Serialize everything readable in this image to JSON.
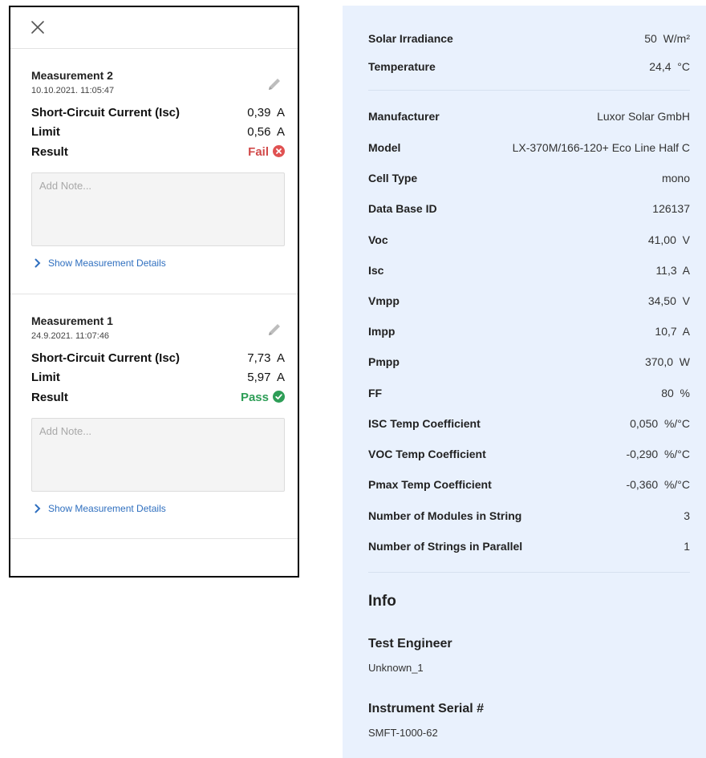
{
  "measurements": [
    {
      "title": "Measurement 2",
      "date": "10.10.2021. 11:05:47",
      "isc_label": "Short-Circuit Current (Isc)",
      "isc_value": "0,39  A",
      "limit_label": "Limit",
      "limit_value": "0,56  A",
      "result_label": "Result",
      "result_value": "Fail",
      "result_status": "fail",
      "note_placeholder": "Add Note...",
      "details_link": "Show Measurement Details"
    },
    {
      "title": "Measurement 1",
      "date": "24.9.2021. 11:07:46",
      "isc_label": "Short-Circuit Current (Isc)",
      "isc_value": "7,73  A",
      "limit_label": "Limit",
      "limit_value": "5,97  A",
      "result_label": "Result",
      "result_value": "Pass",
      "result_status": "pass",
      "note_placeholder": "Add Note...",
      "details_link": "Show Measurement Details"
    }
  ],
  "conditions": [
    {
      "label": "Solar Irradiance",
      "value": "50  W/m²"
    },
    {
      "label": "Temperature",
      "value": "24,4  °C"
    }
  ],
  "module": [
    {
      "label": "Manufacturer",
      "value": "Luxor Solar GmbH"
    },
    {
      "label": "Model",
      "value": "LX-370M/166-120+ Eco Line Half C"
    },
    {
      "label": "Cell Type",
      "value": "mono"
    },
    {
      "label": "Data Base ID",
      "value": "126137"
    },
    {
      "label": "Voc",
      "value": "41,00  V"
    },
    {
      "label": "Isc",
      "value": "11,3  A"
    },
    {
      "label": "Vmpp",
      "value": "34,50  V"
    },
    {
      "label": "Impp",
      "value": "10,7  A"
    },
    {
      "label": "Pmpp",
      "value": "370,0  W"
    },
    {
      "label": "FF",
      "value": "80  %"
    },
    {
      "label": "ISC Temp Coefficient",
      "value": "0,050  %/°C"
    },
    {
      "label": "VOC Temp Coefficient",
      "value": "-0,290  %/°C"
    },
    {
      "label": "Pmax Temp Coefficient",
      "value": "-0,360  %/°C"
    },
    {
      "label": "Number of Modules in String",
      "value": "3"
    },
    {
      "label": "Number of Strings in Parallel",
      "value": "1"
    }
  ],
  "info": {
    "heading": "Info",
    "test_engineer_label": "Test Engineer",
    "test_engineer_value": "Unknown_1",
    "serial_label": "Instrument Serial #",
    "serial_value": "SMFT-1000-62"
  },
  "colors": {
    "fail": "#d14a4a",
    "pass": "#2e9e57",
    "link": "#2f6fbf",
    "right_panel_bg": "#e9f1fd"
  },
  "icons": {
    "close": "close-icon",
    "edit": "pencil-icon",
    "fail": "x-circle-icon",
    "pass": "check-circle-icon",
    "chevron": "chevron-right-icon"
  }
}
